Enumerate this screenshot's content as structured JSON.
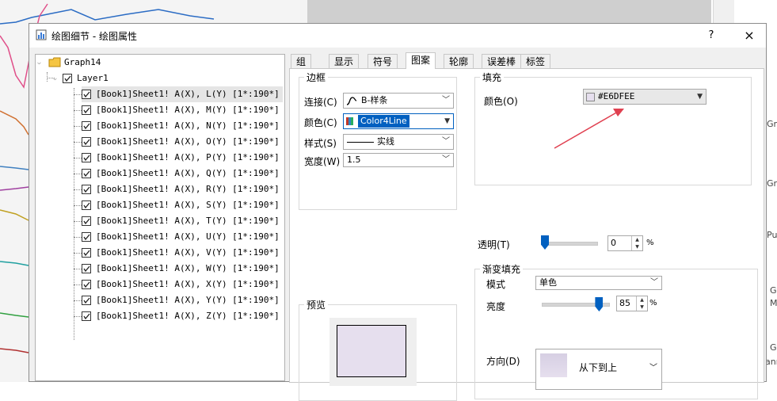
{
  "dialog": {
    "title": "绘图细节 - 绘图属性",
    "help": "?",
    "close": "×"
  },
  "tree": {
    "graph": "Graph14",
    "layer": "Layer1",
    "items": [
      "[Book1]Sheet1! A(X), L(Y) [1*:190*]",
      "[Book1]Sheet1! A(X), M(Y) [1*:190*]",
      "[Book1]Sheet1! A(X), N(Y) [1*:190*]",
      "[Book1]Sheet1! A(X), O(Y) [1*:190*]",
      "[Book1]Sheet1! A(X), P(Y) [1*:190*]",
      "[Book1]Sheet1! A(X), Q(Y) [1*:190*]",
      "[Book1]Sheet1! A(X), R(Y) [1*:190*]",
      "[Book1]Sheet1! A(X), S(Y) [1*:190*]",
      "[Book1]Sheet1! A(X), T(Y) [1*:190*]",
      "[Book1]Sheet1! A(X), U(Y) [1*:190*]",
      "[Book1]Sheet1! A(X), V(Y) [1*:190*]",
      "[Book1]Sheet1! A(X), W(Y) [1*:190*]",
      "[Book1]Sheet1! A(X), X(Y) [1*:190*]",
      "[Book1]Sheet1! A(X), Y(Y) [1*:190*]",
      "[Book1]Sheet1! A(X), Z(Y) [1*:190*]"
    ]
  },
  "tabs": [
    "组",
    "显示",
    "符号",
    "图案",
    "轮廓",
    "误差棒",
    "标签"
  ],
  "border_group": {
    "title": "边框",
    "connect_label": "连接(C)",
    "connect_value": "B-样条",
    "color_label": "颜色(C)",
    "color_value": "Color4Line",
    "style_label": "样式(S)",
    "style_value": "实线",
    "width_label": "宽度(W)",
    "width_value": "1.5"
  },
  "fill_group": {
    "title": "填充",
    "color_label": "颜色(O)",
    "color_value": "#E6DFEE",
    "swatch": "#E6DFEE"
  },
  "transparency": {
    "label": "透明(T)",
    "value": "0",
    "unit": "%",
    "fraction": 0.0
  },
  "gradient_group": {
    "title": "渐变填充",
    "mode_label": "模式",
    "mode_value": "单色",
    "brightness_label": "亮度",
    "brightness_value": "85",
    "brightness_unit": "%",
    "brightness_fraction": 0.85,
    "direction_label": "方向(D)",
    "direction_value": "从下到上"
  },
  "preview": {
    "title": "预览"
  },
  "colors": {
    "accent": "#0060c0",
    "arrow": "#e04050",
    "preview_fill": "#E6DFEE"
  },
  "background_fragments": [
    "Gra",
    "Gra",
    "Pub",
    "G",
    "M",
    "G",
    "ann"
  ]
}
